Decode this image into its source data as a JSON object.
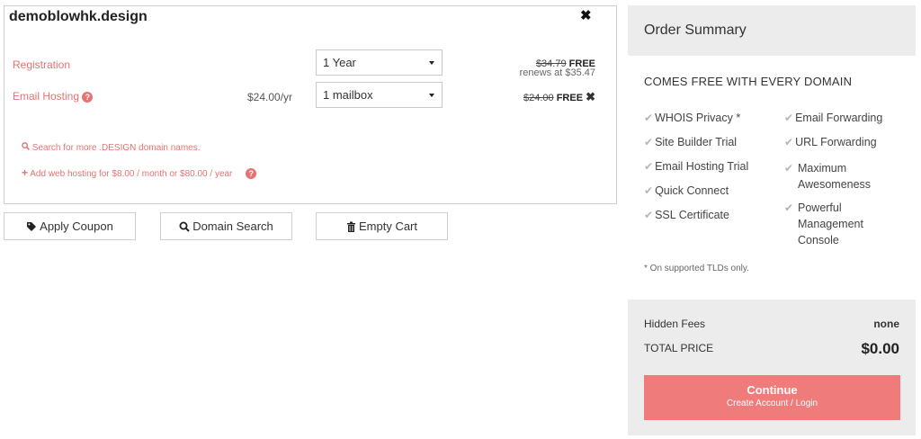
{
  "domain": {
    "name": "demoblowhk.design",
    "close_glyph": "✖",
    "registration": {
      "label": "Registration",
      "term": "1 Year",
      "old_price": "$34.79",
      "free_label": "FREE",
      "renews": "renews at $35.47"
    },
    "email": {
      "label": "Email Hosting",
      "unit_price": "$24.00/yr",
      "plan": "1 mailbox",
      "old_price": "$24.00",
      "free_label": "FREE"
    },
    "links": {
      "search_more": "Search for more .DESIGN domain names.",
      "add_hosting": "Add web hosting for $8.00 / month or $80.00 / year"
    }
  },
  "buttons": {
    "apply_coupon": "Apply Coupon",
    "domain_search": "Domain Search",
    "empty_cart": "Empty Cart"
  },
  "summary": {
    "title": "Order Summary",
    "free_title": "COMES FREE WITH EVERY DOMAIN",
    "features_left": [
      "WHOIS Privacy *",
      "Site Builder Trial",
      "Email Hosting Trial",
      "Quick Connect",
      "SSL Certificate"
    ],
    "features_right": [
      "Email Forwarding",
      "URL Forwarding",
      "Maximum Awesomeness",
      "Powerful Management Console"
    ],
    "note": "* On supported TLDs only.",
    "hidden_fees_label": "Hidden Fees",
    "hidden_fees_value": "none",
    "total_label": "TOTAL PRICE",
    "total_value": "$0.00",
    "continue_label": "Continue",
    "continue_sub": "Create Account / Login"
  },
  "colors": {
    "accent": "#e57373",
    "continue_bg": "#f07b7b",
    "panel_bg": "#ececec"
  },
  "icons": {
    "help": "question-circle-icon",
    "tag": "tag-icon",
    "search": "search-icon",
    "trash": "trash-icon",
    "plus": "plus-icon",
    "check": "check-icon",
    "remove": "times-icon"
  }
}
